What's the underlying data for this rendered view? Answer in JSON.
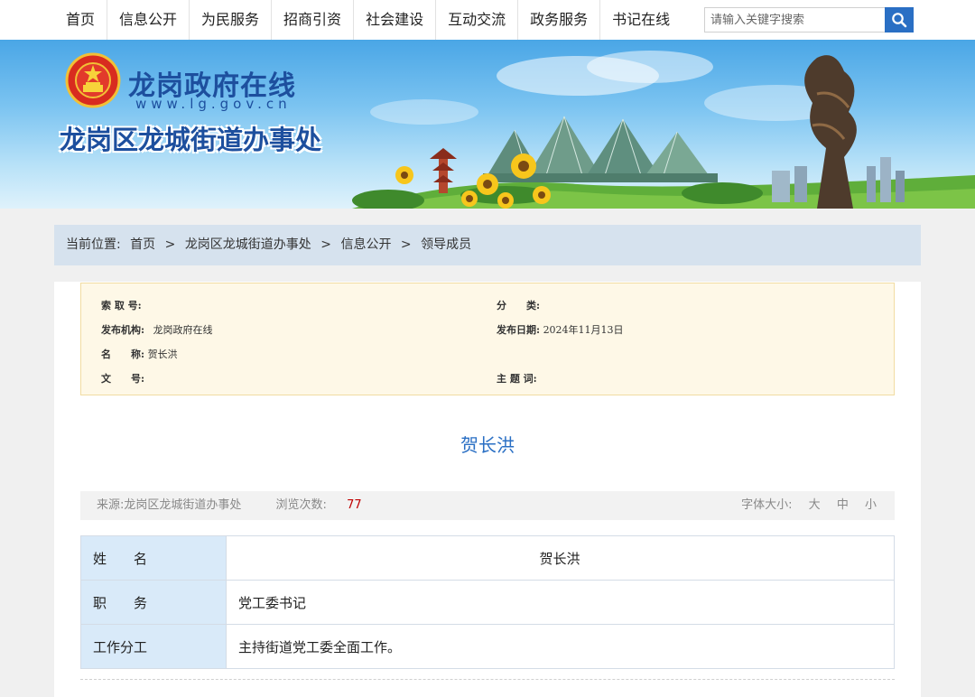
{
  "nav": {
    "items": [
      {
        "label": "首页"
      },
      {
        "label": "信息公开"
      },
      {
        "label": "为民服务"
      },
      {
        "label": "招商引资"
      },
      {
        "label": "社会建设"
      },
      {
        "label": "互动交流"
      },
      {
        "label": "政务服务"
      },
      {
        "label": "书记在线"
      }
    ],
    "search_placeholder": "请输入关键字搜索"
  },
  "banner": {
    "site_name": "龙岗政府在线",
    "site_url": "www.lg.gov.cn",
    "office_name": "龙岗区龙城街道办事处"
  },
  "breadcrumb": {
    "prefix": "当前位置:",
    "items": [
      "首页",
      "龙岗区龙城街道办事处",
      "信息公开",
      "领导成员"
    ],
    "separator": ">"
  },
  "meta": {
    "index_label": "索 取 号:",
    "index_value": "",
    "category_label": "分　　类:",
    "category_value": "",
    "publisher_label": "发布机构:",
    "publisher_value": "龙岗政府在线",
    "date_label": "发布日期:",
    "date_value": "2024年11月13日",
    "name_label": "名　　称:",
    "name_value": "贺长洪",
    "docno_label": "文　　号:",
    "docno_value": "",
    "topic_label": "主 题 词:",
    "topic_value": ""
  },
  "article": {
    "title": "贺长洪",
    "source_label": "来源:",
    "source_value": "龙岗区龙城街道办事处",
    "views_label": "浏览次数:",
    "views_value": "77",
    "font_label": "字体大小:",
    "font_large": "大",
    "font_medium": "中",
    "font_small": "小"
  },
  "profile": {
    "rows": [
      {
        "key": "姓　　名",
        "value": "贺长洪"
      },
      {
        "key": "职　　务",
        "value": "党工委书记"
      },
      {
        "key": "工作分工",
        "value": "主持街道党工委全面工作。"
      }
    ]
  },
  "colors": {
    "accent": "#2a6fc4",
    "breadcrumb_bg": "#d6e2ee",
    "meta_bg": "#fef8e7",
    "table_key_bg": "#d9eaf9",
    "views_color": "#c00000"
  }
}
